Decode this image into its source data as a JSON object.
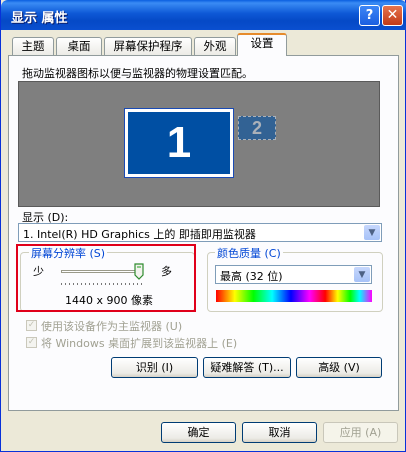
{
  "window": {
    "title": "显示 属性",
    "help_label": "?",
    "close_label": "✕"
  },
  "tabs": [
    {
      "label": "主题"
    },
    {
      "label": "桌面"
    },
    {
      "label": "屏幕保护程序"
    },
    {
      "label": "外观"
    },
    {
      "label": "设置"
    }
  ],
  "settings": {
    "instruction": "拖动监视器图标以便与监视器的物理设置匹配。",
    "monitor_1": "1",
    "monitor_2": "2",
    "display_label": "显示 (D):",
    "display_value": "1. Intel(R) HD Graphics 上的 即插即用监视器",
    "resolution": {
      "group_label": "屏幕分辨率 (S)",
      "less_label": "少",
      "more_label": "多",
      "value": "1440 x 900 像素",
      "slider_level": 1.0
    },
    "color_quality": {
      "group_label": "颜色质量 (C)",
      "value": "最高 (32 位)"
    },
    "checkbox_primary": "使用该设备作为主监视器 (U)",
    "checkbox_extend": "将 Windows 桌面扩展到该监视器上 (E)",
    "btn_identify": "识别 (I)",
    "btn_troubleshoot": "疑难解答 (T)...",
    "btn_advanced": "高级 (V)"
  },
  "footer": {
    "ok": "确定",
    "cancel": "取消",
    "apply": "应用 (A)"
  },
  "colors": {
    "titlebar": "#0a4fd0",
    "monitor_blue": "#004fa3",
    "group_label": "#0046d5",
    "highlight_box": "#e0001a"
  }
}
